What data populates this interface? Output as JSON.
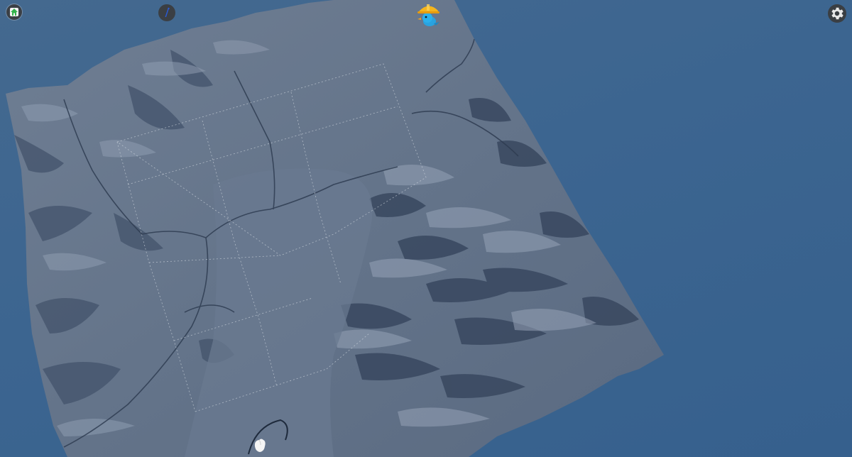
{
  "app": {
    "view": "3d-terrain-map"
  },
  "toolbar": {
    "home_icon": "home-icon",
    "info_icon": "info-icon",
    "settings_icon": "gear-icon"
  },
  "mascot": {
    "icon": "construction-bird-mascot"
  },
  "map": {
    "style": "hillshade-relief",
    "graticule": "dotted-grid",
    "colors": {
      "background": "#3c6590",
      "terrain_light": "#7f8fa4",
      "terrain_base": "#5f6f86",
      "terrain_shadow": "#33425a",
      "grid": "#cfd6de"
    }
  }
}
